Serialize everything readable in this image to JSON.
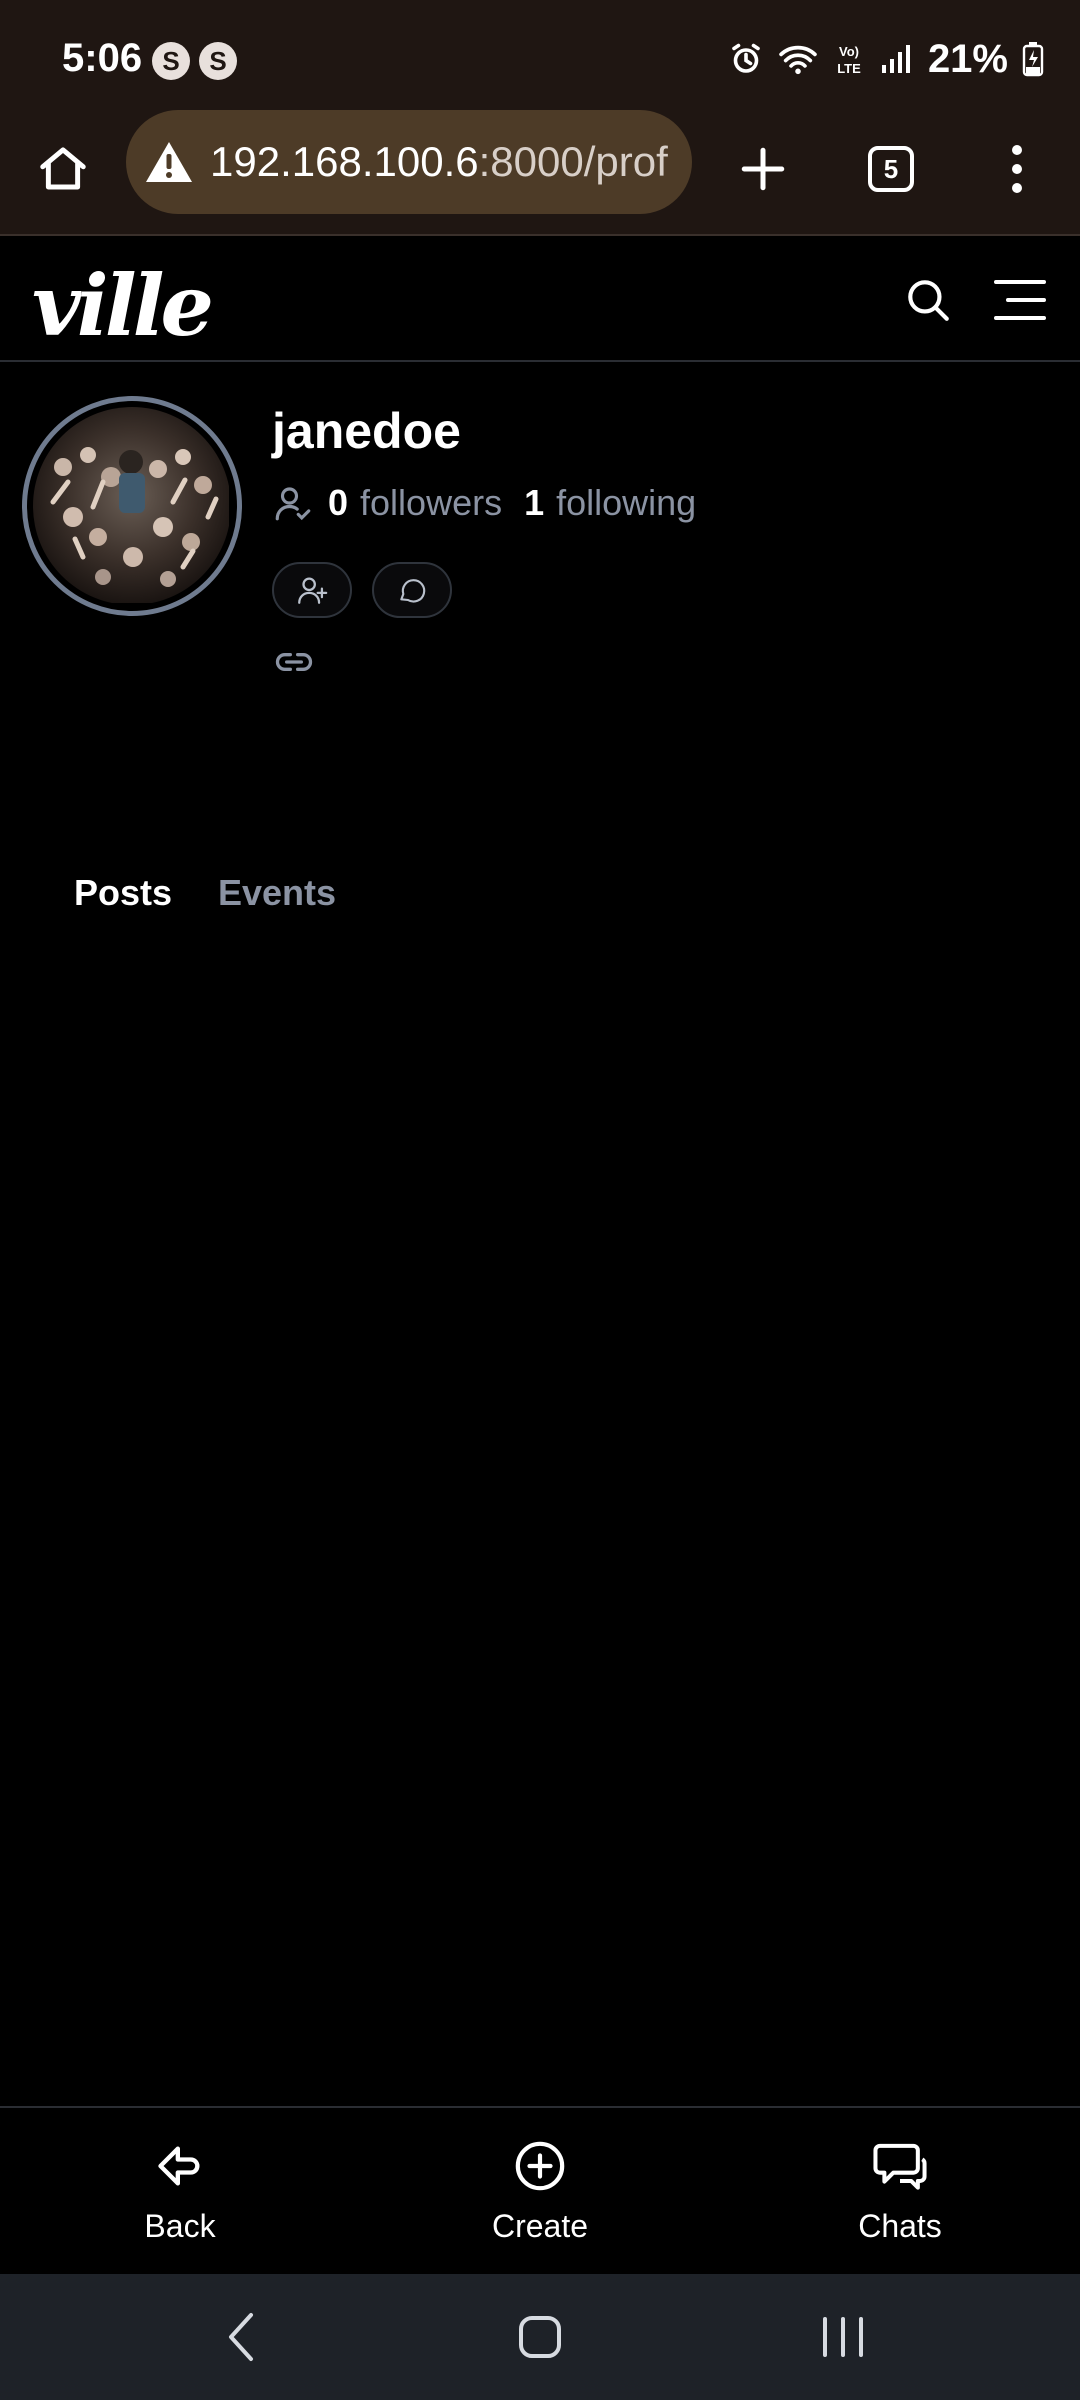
{
  "status_bar": {
    "time": "5:06",
    "app_icons": [
      "S",
      "S"
    ],
    "battery": "21%",
    "network_label": "VoLTE"
  },
  "browser": {
    "url_host": "192.168.100.6",
    "url_rest": ":8000/prof",
    "tab_count": "5",
    "icons": [
      "home-icon",
      "warning-icon",
      "new-tab-icon",
      "tab-switcher-icon",
      "more-menu-icon"
    ]
  },
  "header": {
    "logo": "ville",
    "icons": [
      "search-icon",
      "hamburger-menu-icon"
    ]
  },
  "profile": {
    "username": "janedoe",
    "followers_count": "0",
    "followers_label": "followers",
    "following_count": "1",
    "following_label": "following",
    "action_icons": [
      "follow-icon",
      "message-icon",
      "link-icon"
    ]
  },
  "tabs": [
    {
      "label": "Posts",
      "active": true
    },
    {
      "label": "Events",
      "active": false
    }
  ],
  "bottom_nav": [
    {
      "label": "Back",
      "icon": "back-arrow-icon"
    },
    {
      "label": "Create",
      "icon": "plus-circle-icon"
    },
    {
      "label": "Chats",
      "icon": "chat-bubbles-icon"
    }
  ],
  "colors": {
    "browser_bg": "#1f1612",
    "url_pill": "#4d3b27",
    "page_bg": "#000000",
    "muted_text": "#8b93a3",
    "system_nav_bg": "#1e2228"
  }
}
